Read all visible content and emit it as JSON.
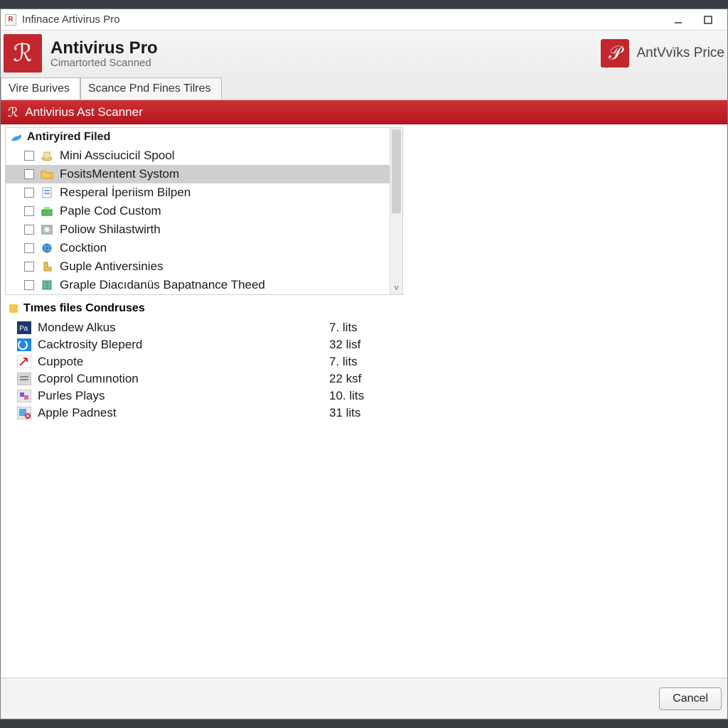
{
  "window": {
    "title": "Infinace Artivirus Pro"
  },
  "header": {
    "title": "Antivirus Pro",
    "subtitle": "Cimartorted Scanned",
    "right_label": "AntVvïks Price"
  },
  "tabs": [
    {
      "label": "Vire Burives",
      "active": true
    },
    {
      "label": "Scance Pnd Fines Tilres",
      "active": false
    }
  ],
  "redbar": {
    "label": "Antivirius Ast Scanner"
  },
  "filed": {
    "heading": "Antiryired Filed",
    "items": [
      {
        "label": "Mini Assciucicil Spool",
        "icon": "spool",
        "selected": false
      },
      {
        "label": "FositsMentent Systom",
        "icon": "folder",
        "selected": true
      },
      {
        "label": "Resperal İperiism Bilpen",
        "icon": "doc",
        "selected": false
      },
      {
        "label": "Paple Cod Custom",
        "icon": "green",
        "selected": false
      },
      {
        "label": "Poliow Shilastwirth",
        "icon": "disk",
        "selected": false
      },
      {
        "label": "Cocktion",
        "icon": "globe",
        "selected": false
      },
      {
        "label": "Guple Antiversinies",
        "icon": "boot",
        "selected": false
      },
      {
        "label": "Graple Diacıdanüs Bapatnance Theed",
        "icon": "book",
        "selected": false
      }
    ]
  },
  "times": {
    "heading": "Tımes files Condruses",
    "rows": [
      {
        "name": "Mondew Alkus",
        "value": "7. lits",
        "icon": "pa"
      },
      {
        "name": "Cacktrosity Bleperd",
        "value": "32 lisf",
        "icon": "cblue"
      },
      {
        "name": "Cuppote",
        "value": "7. lits",
        "icon": "redarrow"
      },
      {
        "name": "Coprol Cumınotion",
        "value": "22 ksf",
        "icon": "gray"
      },
      {
        "name": "Purles Plays",
        "value": "10. lits",
        "icon": "purple"
      },
      {
        "name": "Apple Padnest",
        "value": "31 lits",
        "icon": "redx"
      }
    ]
  },
  "footer": {
    "cancel": "Cancel"
  }
}
